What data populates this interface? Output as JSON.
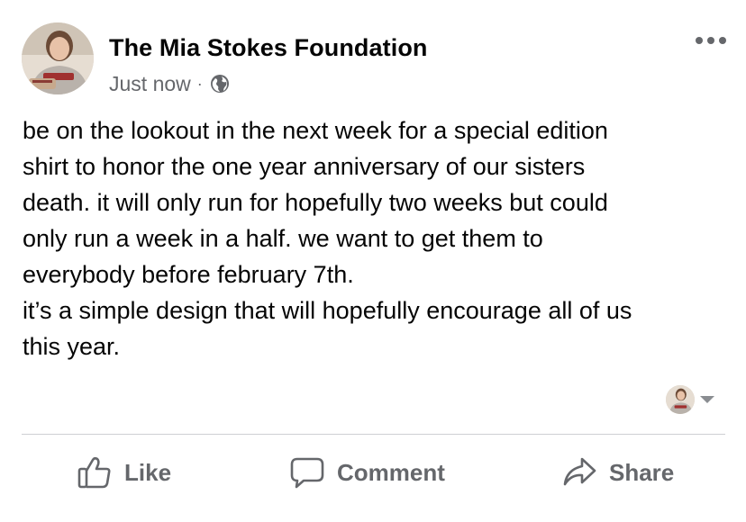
{
  "post": {
    "page_name": "The Mia Stokes Foundation",
    "timestamp": "Just now",
    "separator": "·",
    "privacy_icon": "globe-icon",
    "menu_icon": "more-options-icon",
    "body_lines": [
      "be on the lookout in the next week for a special edition",
      "shirt to honor the one year anniversary of our sisters",
      "death. it will only run for hopefully two weeks but could",
      "only run a week in a half. we want to get them to",
      "everybody before february 7th.",
      "it’s a simple design that will hopefully encourage all of us",
      "this year."
    ]
  },
  "actions": {
    "like_label": "Like",
    "comment_label": "Comment",
    "share_label": "Share"
  },
  "colors": {
    "text": "#050505",
    "secondary_text": "#65676b",
    "divider": "#ced0d4",
    "background": "#ffffff"
  }
}
